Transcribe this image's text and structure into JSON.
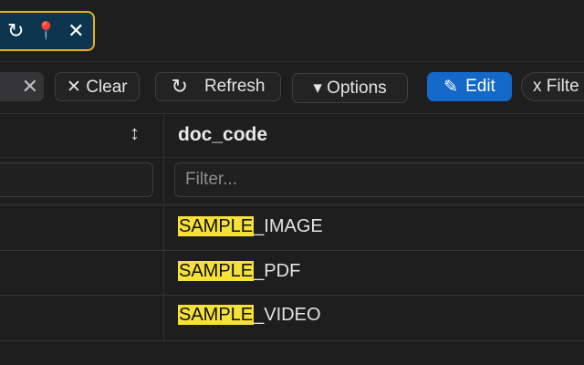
{
  "tab": {
    "icons": [
      "refresh-icon",
      "pin-icon",
      "close-icon"
    ],
    "refresh_glyph": "↻",
    "pin_glyph": "📍",
    "close_glyph": "✕"
  },
  "toolbar": {
    "search_clear_glyph": "✕",
    "clear_label": "✕ Clear",
    "refresh_glyph": "↻",
    "refresh_label": "Refresh",
    "options_label": "▾ Options",
    "edit_glyph": "✎",
    "edit_label": "Edit",
    "filter_chip_label": "x Filte"
  },
  "table": {
    "sort_glyph": "↕",
    "column_header": "doc_code",
    "filter_placeholder": "Filter...",
    "highlight_term": "SAMPLE",
    "rows": [
      {
        "match": "SAMPLE",
        "rest": "_IMAGE"
      },
      {
        "match": "SAMPLE",
        "rest": "_PDF"
      },
      {
        "match": "SAMPLE",
        "rest": "_VIDEO"
      }
    ]
  },
  "colors": {
    "background": "#1e1e1f",
    "tab_bg": "#0d3550",
    "tab_border": "#e8b21a",
    "edit_button": "#1469c8",
    "highlight": "#f5e13a"
  }
}
